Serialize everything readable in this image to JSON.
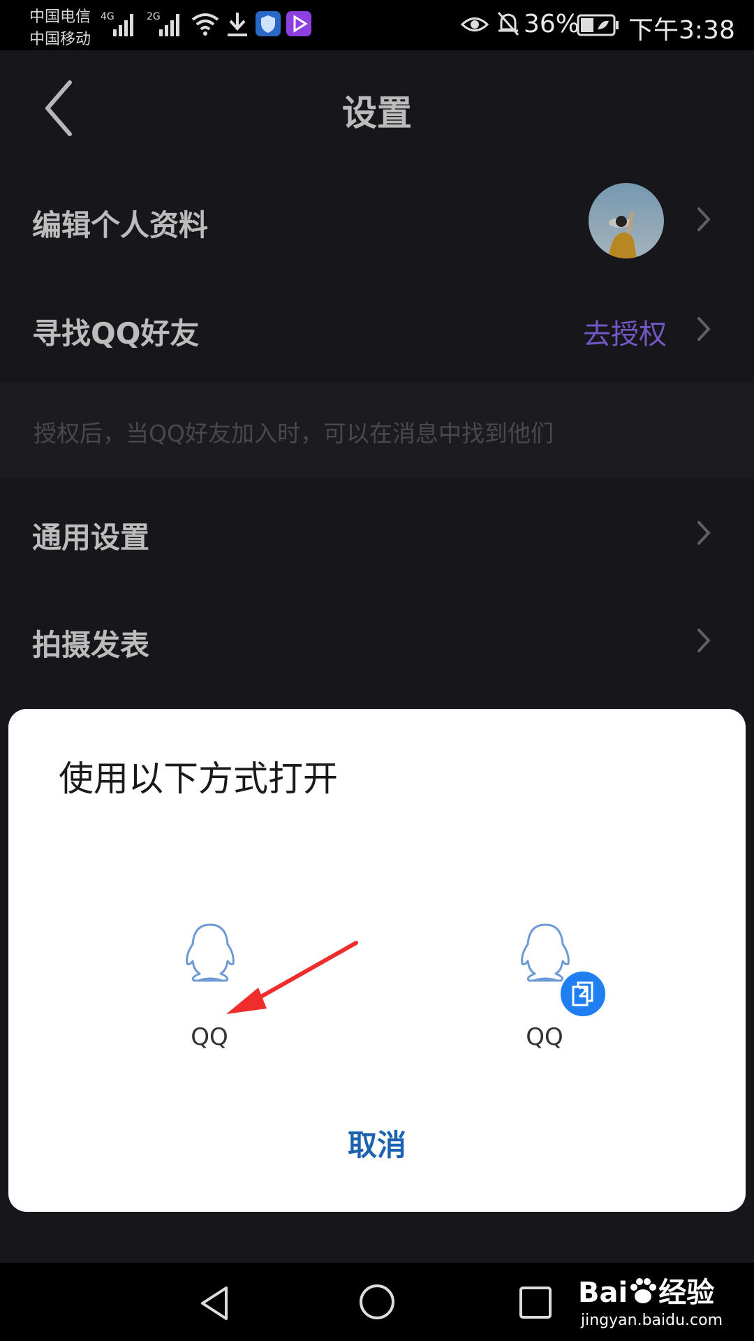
{
  "status_bar": {
    "carrier_1": "中国电信",
    "carrier_2": "中国移动",
    "net_1": "4G",
    "net_2": "2G",
    "battery_percent": "36%",
    "time": "下午3:38",
    "icons": [
      "signal-icon",
      "wifi-icon",
      "download-icon",
      "shield-app-icon",
      "video-app-icon",
      "eye-icon",
      "bell-muted-icon",
      "battery-icon"
    ]
  },
  "header": {
    "title": "设置"
  },
  "rows": {
    "edit_profile": "编辑个人资料",
    "find_qq_friends": "寻找QQ好友",
    "authorize_link": "去授权",
    "hint": "授权后，当QQ好友加入时，可以在消息中找到他们",
    "general_settings": "通用设置",
    "capture_publish": "拍摄发表"
  },
  "dialog": {
    "title": "使用以下方式打开",
    "options": [
      {
        "label": "QQ"
      },
      {
        "label": "QQ",
        "badge": "2"
      }
    ],
    "cancel": "取消"
  },
  "watermark": {
    "brand_1": "Bai",
    "brand_2": "经验",
    "url": "jingyan.baidu.com"
  },
  "colors": {
    "accent_purple": "#8a6cf0",
    "cancel_blue": "#1b63b0",
    "badge_blue": "#1f7ef2"
  }
}
